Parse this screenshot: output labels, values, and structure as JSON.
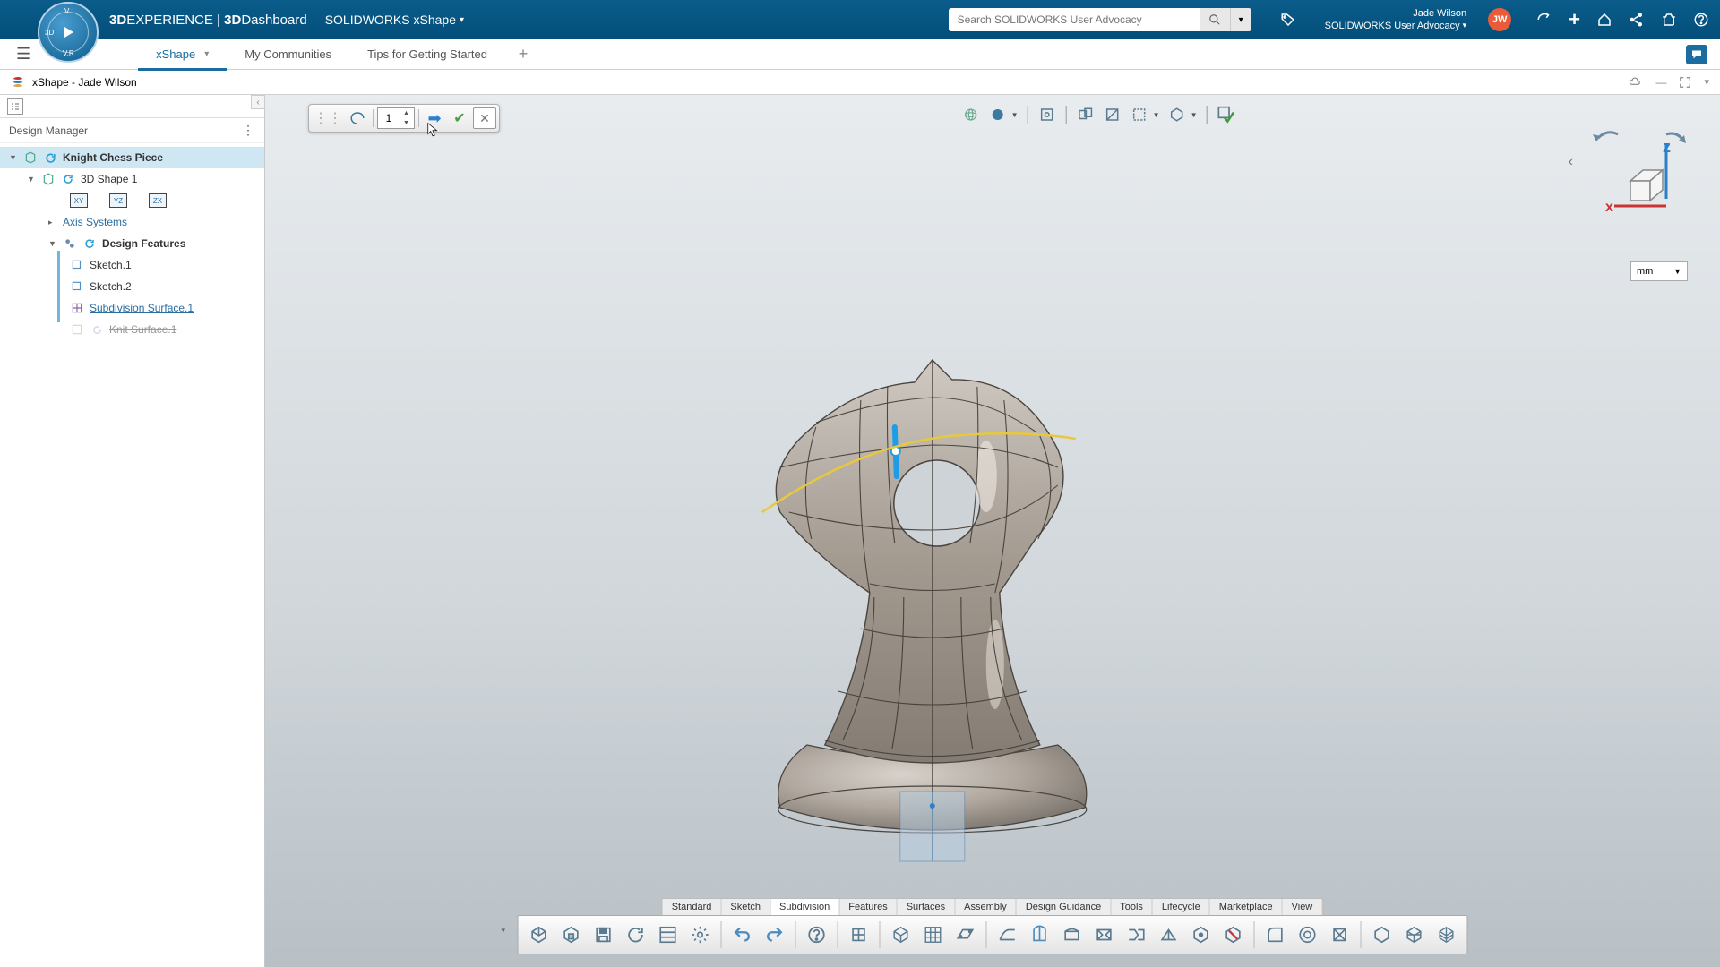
{
  "header": {
    "brand_html_prefix": "3D",
    "brand_experience": "EXPERIENCE",
    "brand_sep": " | ",
    "brand_dash_prefix": "3D",
    "brand_dashboard": "Dashboard",
    "breadcrumb_app": "SOLIDWORKS xShape",
    "search_placeholder": "Search SOLIDWORKS User Advocacy",
    "user_name": "Jade Wilson",
    "user_org": "SOLIDWORKS User Advocacy",
    "avatar_initials": "JW"
  },
  "tabs": {
    "items": [
      "xShape",
      "My Communities",
      "Tips for Getting Started"
    ],
    "active_index": 0
  },
  "docrow": {
    "title": "xShape - Jade Wilson"
  },
  "design_manager": {
    "title": "Design Manager",
    "root": "Knight Chess Piece",
    "shape": "3D Shape 1",
    "axis": "Axis Systems",
    "features": "Design Features",
    "children": [
      {
        "label": "Sketch.1",
        "type": "sketch"
      },
      {
        "label": "Sketch.2",
        "type": "sketch"
      },
      {
        "label": "Subdivision Surface.1",
        "type": "subdiv",
        "link": true
      },
      {
        "label": "Knit Surface.1",
        "type": "knit",
        "ghost": true
      }
    ]
  },
  "float_toolbar": {
    "spinner_value": "1"
  },
  "unit": "mm",
  "axes": {
    "x": "x",
    "z": "z"
  },
  "bottom_tabs": [
    "Standard",
    "Sketch",
    "Subdivision",
    "Features",
    "Surfaces",
    "Assembly",
    "Design Guidance",
    "Tools",
    "Lifecycle",
    "Marketplace",
    "View"
  ],
  "bottom_active": 2,
  "bottom_tools": [
    "new-icon",
    "open-icon",
    "save-icon",
    "update-icon",
    "properties-icon",
    "settings-icon",
    "|",
    "undo-icon",
    "redo-icon",
    "|",
    "help-icon",
    "|",
    "primitive-box-icon",
    "|",
    "subdiv-box-icon",
    "subdiv-grid-icon",
    "subdiv-plane-icon",
    "|",
    "extrude-side-icon",
    "subdiv-cage-icon",
    "bend-icon",
    "loop-cut-icon",
    "bridge-icon",
    "crease-icon",
    "box-deform-icon",
    "delete-face-icon",
    "|",
    "fillet-icon",
    "shell-icon",
    "pattern-icon",
    "|",
    "cube-icon",
    "wireframe-icon",
    "mesh-icon"
  ]
}
